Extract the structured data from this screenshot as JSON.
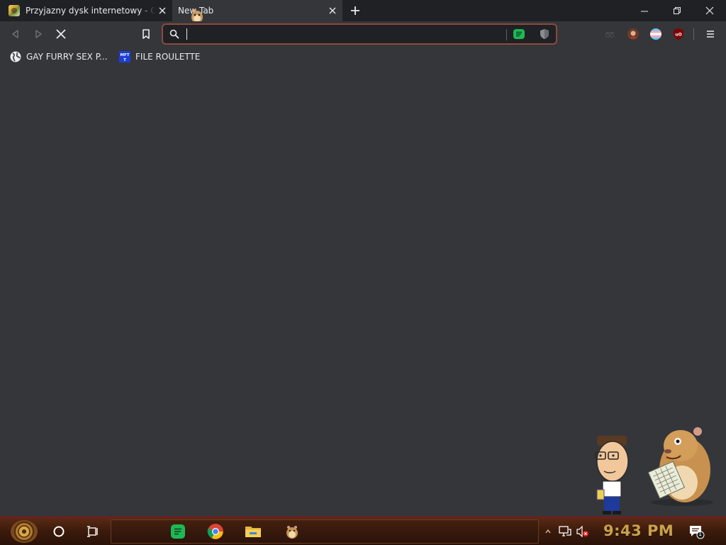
{
  "tabs": [
    {
      "title": "Przyjazny dysk internetowy - Chomikuj.pl",
      "active": false,
      "favicon": "chomikuj-hamster-icon"
    },
    {
      "title": "New Tab",
      "active": true
    }
  ],
  "window_controls": {
    "minimize": "minimize-icon",
    "restore": "restore-icon",
    "close": "close-icon"
  },
  "toolbar": {
    "omnibox_value": "",
    "extensions": [
      "spotify-icon",
      "shield-icon",
      "incognito-icon",
      "avatar-icon",
      "trans-flag-icon",
      "ublock-icon"
    ]
  },
  "bookmarks": [
    {
      "label": "GAY FURRY SEX P...",
      "icon": "globe-icon"
    },
    {
      "label": "FILE ROULETTE",
      "icon": "mft-icon"
    }
  ],
  "taskbar": {
    "apps": [
      "spotify-icon",
      "chrome-icon",
      "file-explorer-icon",
      "hamster-icon"
    ],
    "clock": "9:43 PM",
    "notification_count": "1"
  },
  "colors": {
    "tab_bg": "#202124",
    "active_tab_bg": "#35363a",
    "omnibox_border": "#8c4a3e",
    "clock": "#c8a24a",
    "spotify": "#1db954",
    "taskbar_border": "#7a1a1a"
  }
}
